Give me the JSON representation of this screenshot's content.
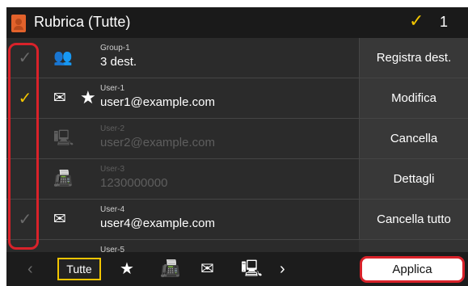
{
  "header": {
    "icon": "address-book-icon",
    "title": "Rubrica (Tutte)",
    "selected_count": "1",
    "check_color": "#f2c500"
  },
  "entries": [
    {
      "name": "Group-1",
      "value": "3 dest.",
      "type": "group-icon",
      "checked": false,
      "favorite": false,
      "enabled": true
    },
    {
      "name": "User-1",
      "value": "user1@example.com",
      "type": "email-icon",
      "checked": true,
      "favorite": true,
      "enabled": true
    },
    {
      "name": "User-2",
      "value": "user2@example.com",
      "type": "file-server-icon",
      "checked": false,
      "favorite": false,
      "enabled": false
    },
    {
      "name": "User-3",
      "value": "1230000000",
      "type": "fax-icon",
      "checked": false,
      "favorite": false,
      "enabled": false
    },
    {
      "name": "User-4",
      "value": "user4@example.com",
      "type": "email-icon",
      "checked": false,
      "favorite": false,
      "enabled": true
    },
    {
      "name": "User-5",
      "value": "",
      "type": "",
      "checked": false,
      "favorite": false,
      "enabled": true
    }
  ],
  "side_buttons": {
    "register": "Registra dest.",
    "edit": "Modifica",
    "delete": "Cancella",
    "details": "Dettagli",
    "clear_all": "Cancella tutto"
  },
  "bottom_bar": {
    "tab_all": "Tutte",
    "apply": "Applica",
    "accent_color": "#d9222a"
  }
}
